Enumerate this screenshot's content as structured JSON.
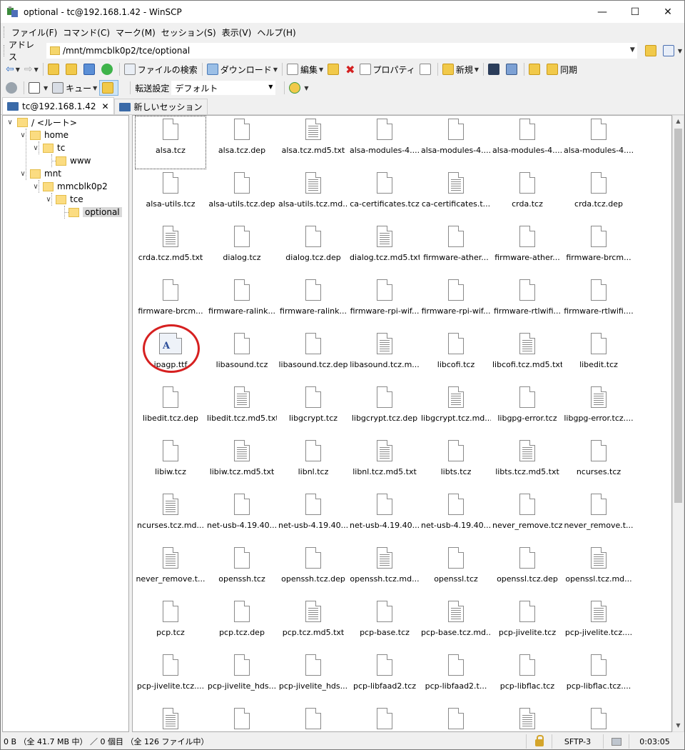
{
  "window": {
    "title": "optional - tc@192.168.1.42 - WinSCP"
  },
  "menu": [
    "ファイル(F)",
    "コマンド(C)",
    "マーク(M)",
    "セッション(S)",
    "表示(V)",
    "ヘルプ(H)"
  ],
  "address": {
    "label": "アドレス",
    "path": "/mnt/mmcblk0p2/tce/optional"
  },
  "toolbar1": {
    "find_files": "ファイルの検索",
    "download": "ダウンロード",
    "edit": "編集",
    "properties": "プロパティ",
    "new": "新規",
    "sync": "同期"
  },
  "toolbar2": {
    "queue": "キュー",
    "transfer_settings_label": "転送設定",
    "transfer_settings_value": "デフォルト"
  },
  "tabs": [
    {
      "label": "tc@192.168.1.42",
      "close": "✕"
    },
    {
      "label": "新しいセッション"
    }
  ],
  "tree": {
    "root": "/ <ルート>",
    "home": "home",
    "tc": "tc",
    "www": "www",
    "mnt": "mnt",
    "mmcblk0p2": "mmcblk0p2",
    "tce": "tce",
    "optional": "optional"
  },
  "files": [
    "alsa.tcz",
    "alsa.tcz.dep",
    "alsa.tcz.md5.txt",
    "alsa-modules-4....",
    "alsa-modules-4....",
    "alsa-modules-4....",
    "alsa-modules-4....",
    "alsa-utils.tcz",
    "alsa-utils.tcz.dep",
    "alsa-utils.tcz.md...",
    "ca-certificates.tcz",
    "ca-certificates.t...",
    "crda.tcz",
    "crda.tcz.dep",
    "crda.tcz.md5.txt",
    "dialog.tcz",
    "dialog.tcz.dep",
    "dialog.tcz.md5.txt",
    "firmware-ather...",
    "firmware-ather...",
    "firmware-brcm...",
    "firmware-brcm...",
    "firmware-ralink...",
    "firmware-ralink...",
    "firmware-rpi-wif...",
    "firmware-rpi-wif...",
    "firmware-rtlwifi...",
    "firmware-rtlwifi....",
    "ipagp.ttf",
    "libasound.tcz",
    "libasound.tcz.dep",
    "libasound.tcz.m...",
    "libcofi.tcz",
    "libcofi.tcz.md5.txt",
    "libedit.tcz",
    "libedit.tcz.dep",
    "libedit.tcz.md5.txt",
    "libgcrypt.tcz",
    "libgcrypt.tcz.dep",
    "libgcrypt.tcz.md...",
    "libgpg-error.tcz",
    "libgpg-error.tcz....",
    "libiw.tcz",
    "libiw.tcz.md5.txt",
    "libnl.tcz",
    "libnl.tcz.md5.txt",
    "libts.tcz",
    "libts.tcz.md5.txt",
    "ncurses.tcz",
    "ncurses.tcz.md...",
    "net-usb-4.19.40...",
    "net-usb-4.19.40...",
    "net-usb-4.19.40...",
    "net-usb-4.19.40...",
    "never_remove.tcz",
    "never_remove.t...",
    "never_remove.t...",
    "openssh.tcz",
    "openssh.tcz.dep",
    "openssh.tcz.md...",
    "openssl.tcz",
    "openssl.tcz.dep",
    "openssl.tcz.md...",
    "pcp.tcz",
    "pcp.tcz.dep",
    "pcp.tcz.md5.txt",
    "pcp-base.tcz",
    "pcp-base.tcz.md...",
    "pcp-jivelite.tcz",
    "pcp-jivelite.tcz....",
    "pcp-jivelite.tcz....",
    "pcp-jivelite_hds...",
    "pcp-jivelite_hds...",
    "pcp-libfaad2.tcz",
    "pcp-libfaad2.t...",
    "pcp-libflac.tcz",
    "pcp-libflac.tcz....",
    "",
    "",
    "",
    "",
    "",
    "",
    ""
  ],
  "file_types": "tcz,dep,txt,tcz,dep,tcz,dep,tcz,dep,txt,tcz,txt,tcz,dep,txt,tcz,dep,txt,tcz,dep,tcz,dep,tcz,dep,tcz,dep,tcz,dep,font,tcz,dep,txt,tcz,txt,tcz,dep,txt,tcz,dep,txt,tcz,txt,tcz,txt,tcz,txt,tcz,txt,tcz,txt,tcz,dep,tcz,dep,tcz,dep,txt,tcz,dep,txt,tcz,dep,txt,tcz,dep,txt,tcz,txt,tcz,txt,tcz,dep,tcz,dep,tcz,dep,tcz,txt,tcz,dep,tcz,dep,txt,tcz,dep",
  "status": {
    "text": "0 B （全 41.7 MB 中） ／ 0 個目 （全 126 ファイル中）",
    "protocol": "SFTP-3",
    "time": "0:03:05"
  }
}
